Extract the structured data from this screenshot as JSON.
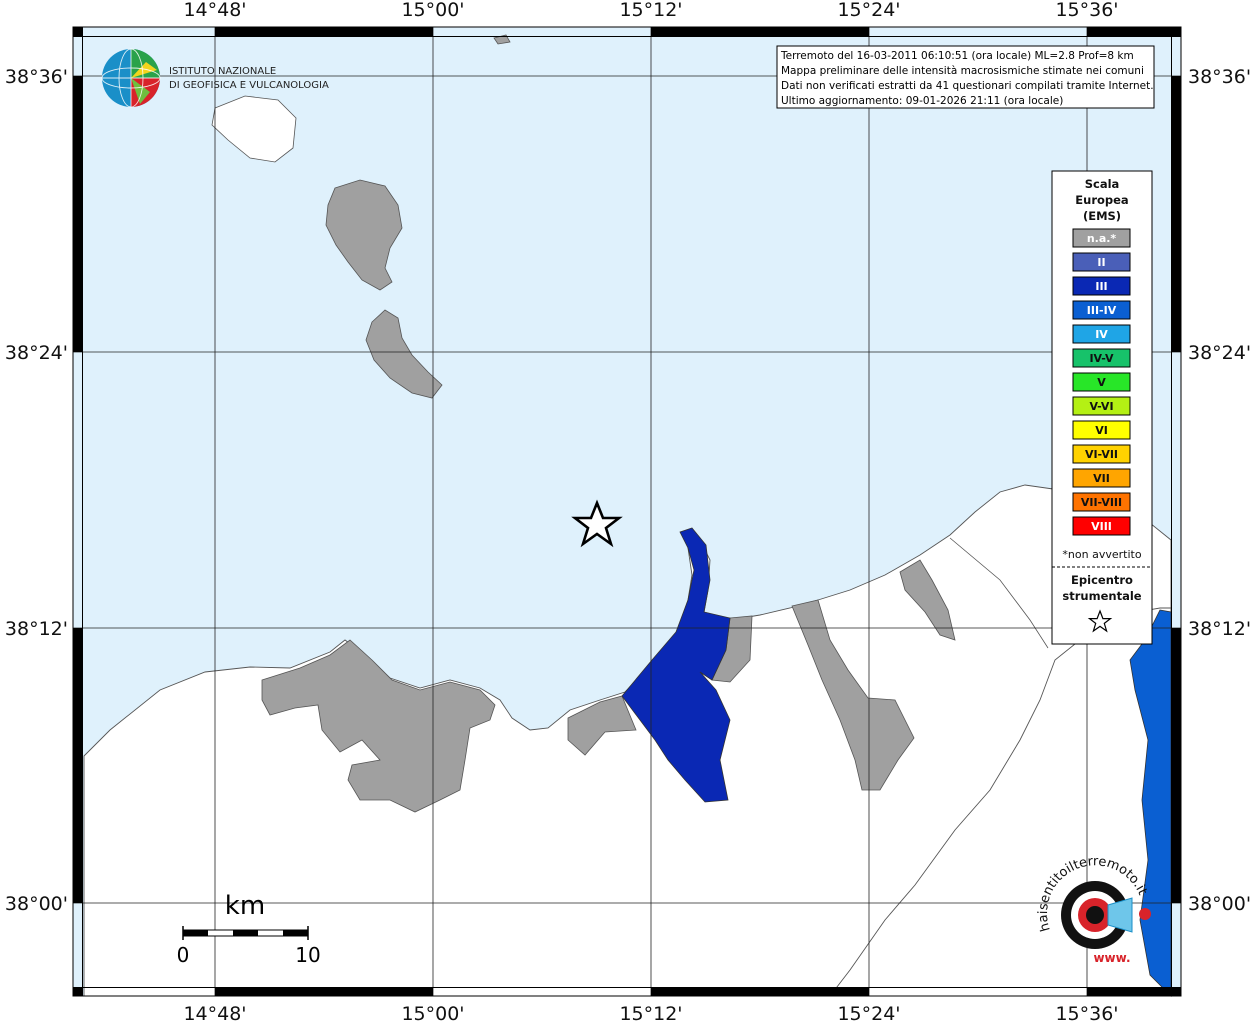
{
  "map": {
    "lon_labels": [
      "14°48'",
      "15°00'",
      "15°12'",
      "15°24'",
      "15°36'"
    ],
    "lat_labels": [
      "38°36'",
      "38°24'",
      "38°12'",
      "38°00'"
    ],
    "colors": {
      "sea": "#dff1fc",
      "land": "#ffffff",
      "na": "#a0a0a0",
      "iii": "#0a28b4",
      "iii_iv": "#0a5fd2"
    }
  },
  "institute": {
    "line1": "ISTITUTO NAZIONALE",
    "line2": "DI GEOFISICA E VULCANOLOGIA"
  },
  "info": {
    "line1": "Terremoto del 16-03-2011 06:10:51 (ora locale) ML=2.8 Prof=8 km",
    "line2": "Mappa preliminare delle intensità macrosismiche stimate nei comuni",
    "line3": "Dati non verificati estratti da 41 questionari compilati tramite Internet.",
    "line4": "Ultimo aggiornamento: 09-01-2026 21:11 (ora locale)"
  },
  "legend": {
    "title1": "Scala",
    "title2": "Europea",
    "title3": "(EMS)",
    "items": [
      {
        "label": "n.a.*",
        "color": "#a0a0a0",
        "text_color": "#ffffff"
      },
      {
        "label": "II",
        "color": "#4a5fb8",
        "text_color": "#ffffff"
      },
      {
        "label": "III",
        "color": "#0a28b4",
        "text_color": "#ffffff"
      },
      {
        "label": "III-IV",
        "color": "#0a5fd2",
        "text_color": "#ffffff"
      },
      {
        "label": "IV",
        "color": "#1fa5e6",
        "text_color": "#ffffff"
      },
      {
        "label": "IV-V",
        "color": "#17c26a",
        "text_color": "#111111"
      },
      {
        "label": "V",
        "color": "#28e628",
        "text_color": "#111111"
      },
      {
        "label": "V-VI",
        "color": "#b4f014",
        "text_color": "#111111"
      },
      {
        "label": "VI",
        "color": "#ffff00",
        "text_color": "#111111"
      },
      {
        "label": "VI-VII",
        "color": "#ffd200",
        "text_color": "#111111"
      },
      {
        "label": "VII",
        "color": "#ffa500",
        "text_color": "#111111"
      },
      {
        "label": "VII-VIII",
        "color": "#ff7300",
        "text_color": "#111111"
      },
      {
        "label": "VIII",
        "color": "#ff0000",
        "text_color": "#ffffff"
      }
    ],
    "note": "*non avvertito",
    "epicenter_line1": "Epicentro",
    "epicenter_line2": "strumentale"
  },
  "scale_bar": {
    "unit": "km",
    "start": "0",
    "end": "10"
  },
  "watermark": {
    "text": "haisentitoilterremoto.it",
    "url": "www."
  }
}
